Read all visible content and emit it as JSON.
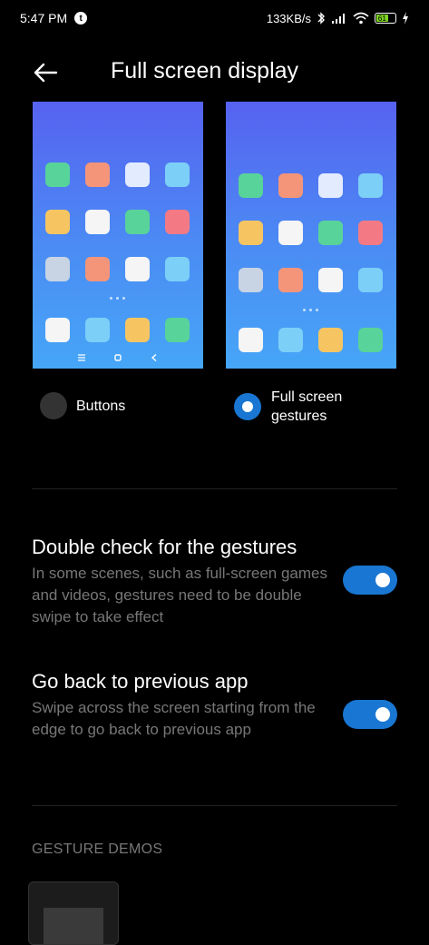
{
  "status_bar": {
    "time": "5:47 PM",
    "network_speed": "133KB/s",
    "battery_level": "61",
    "icons": [
      "t-icon",
      "bluetooth-icon",
      "signal-icon",
      "wifi-icon",
      "battery-icon",
      "charging-icon"
    ]
  },
  "app_bar": {
    "title": "Full screen display",
    "back_icon": "arrow-left-icon"
  },
  "options": {
    "buttons_label": "Buttons",
    "gestures_label_line1": "Full screen",
    "gestures_label_line2": "gestures",
    "selected": "gestures"
  },
  "settings": [
    {
      "title": "Double check for the gestures",
      "description": "In some scenes, such as full-screen games and videos, gestures need to be double swipe to take effect",
      "enabled": true
    },
    {
      "title": "Go back to previous app",
      "description": "Swipe across the screen starting from the edge to go back to previous app",
      "enabled": true
    }
  ],
  "gesture_demos": {
    "header": "GESTURE DEMOS"
  },
  "colors": {
    "accent": "#1976d2",
    "icon_green": "#58d39a",
    "icon_orange": "#f4957a",
    "icon_white": "#f5f5f5",
    "icon_lightwhite": "#e3ecff",
    "icon_sky": "#7ccff7",
    "icon_yellow": "#f6c562",
    "icon_red": "#f37a84",
    "icon_grey": "#c8d4e4"
  }
}
